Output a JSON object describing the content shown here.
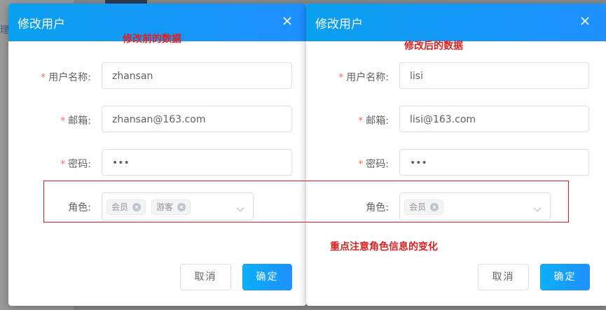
{
  "background": {
    "side_text": "理"
  },
  "left_dialog": {
    "title": "修改用户",
    "fields": {
      "username_label": "用户名称:",
      "username_value": "zhansan",
      "email_label": "邮箱:",
      "email_value": "zhansan@163.com",
      "password_label": "密码:",
      "password_value": "•••",
      "role_label": "角色:"
    },
    "roles": [
      "会员",
      "游客"
    ],
    "cancel_label": "取消",
    "ok_label": "确定"
  },
  "right_dialog": {
    "title": "修改用户",
    "fields": {
      "username_label": "用户名称:",
      "username_value": "lisi",
      "email_label": "邮箱:",
      "email_value": "lisi@163.com",
      "password_label": "密码:",
      "password_value": "•••",
      "role_label": "角色:"
    },
    "roles": [
      "会员"
    ],
    "cancel_label": "取消",
    "ok_label": "确定"
  },
  "annotations": {
    "before": "修改前的数据",
    "after": "修改后的数据",
    "note": "重点注意角色信息的变化"
  },
  "colors": {
    "header": "#0aa0f0",
    "annotation": "#e02020",
    "required": "#f56c6c"
  },
  "icons": {
    "close": "close-icon",
    "tag_remove": "close-circle-icon",
    "select_arrow": "chevron-down-icon"
  }
}
